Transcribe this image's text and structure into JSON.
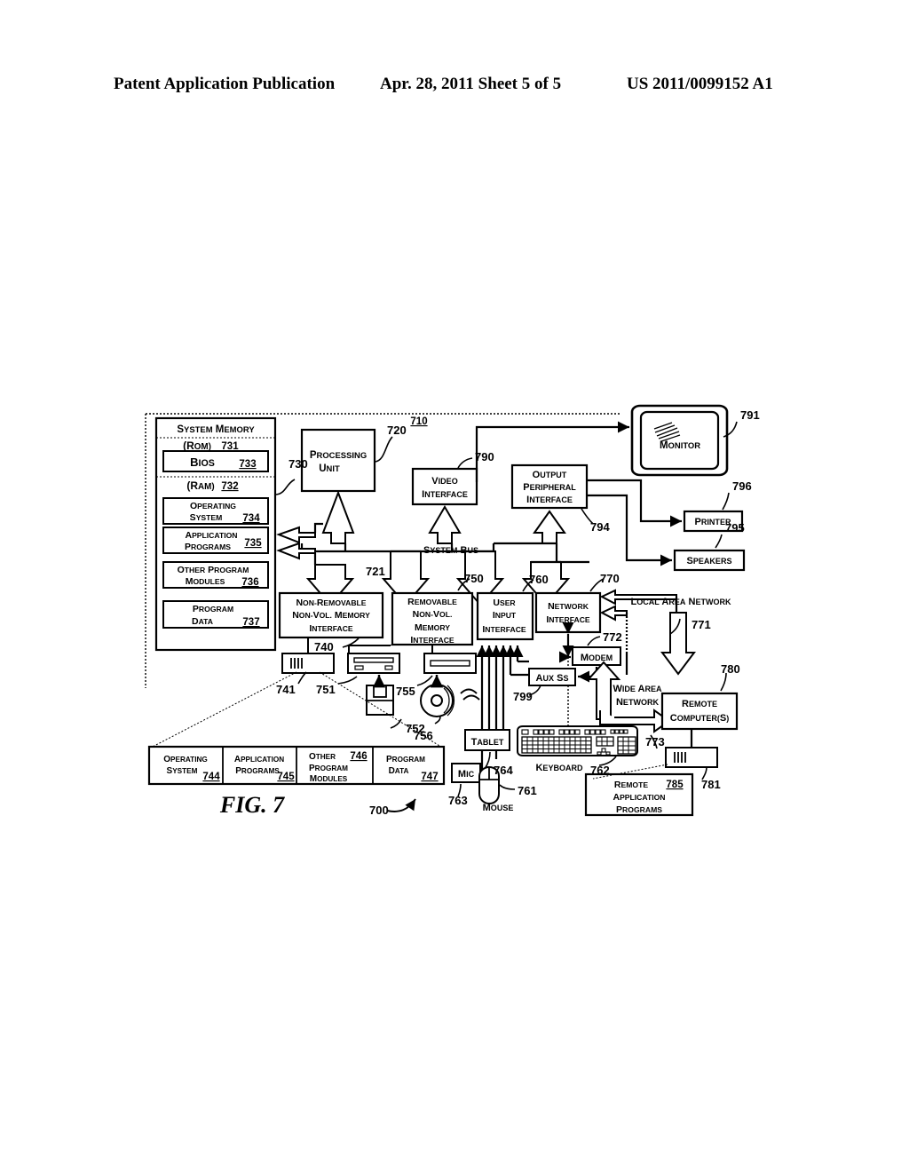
{
  "header": {
    "left": "Patent Application Publication",
    "middle": "Apr. 28, 2011  Sheet 5 of 5",
    "right": "US 2011/0099152 A1"
  },
  "figure": {
    "label": "FIG. 7",
    "ref": "700"
  },
  "diagram": {
    "computer_ref": "710",
    "system_memory": {
      "title": "System Memory",
      "rom_label": "(ROM)",
      "rom_ref": "731",
      "bios_label": "BIOS",
      "bios_ref": "733",
      "ram_label": "(RAM)",
      "ram_ref": "732",
      "memory_ref": "730",
      "blocks": [
        {
          "line1": "Operating",
          "line2": "System",
          "ref": "734"
        },
        {
          "line1": "Application",
          "line2": "Programs",
          "ref": "735"
        },
        {
          "line1": "Other Program",
          "line2": "Modules",
          "ref": "736"
        },
        {
          "line1": "Program",
          "line2": "Data",
          "ref": "737"
        }
      ]
    },
    "processing_unit": {
      "line1": "Processing",
      "line2": "Unit",
      "ref": "720"
    },
    "system_bus": {
      "label": "System Bus",
      "ref": "721"
    },
    "video_interface": {
      "line1": "Video",
      "line2": "Interface",
      "ref": "790"
    },
    "output_peripheral_interface": {
      "line1": "Output",
      "line2": "Peripheral",
      "line3": "Interface",
      "ref": "794"
    },
    "monitor": {
      "label": "Monitor",
      "ref": "791"
    },
    "printer": {
      "label": "Printer",
      "ref": "796"
    },
    "speakers": {
      "label": "Speakers",
      "ref": "795"
    },
    "non_removable_interface": {
      "line1": "Non-Removable",
      "line2": "Non-Vol. Memory",
      "line3": "Interface",
      "ref": "740"
    },
    "removable_interface": {
      "line1": "Removable",
      "line2": "Non-Vol.",
      "line3": "Memory",
      "line4": "Interface",
      "ref": "750"
    },
    "user_input_interface": {
      "line1": "User",
      "line2": "Input",
      "line3": "Interface",
      "ref": "760"
    },
    "network_interface": {
      "line1": "Network",
      "line2": "Interface",
      "ref": "770"
    },
    "hard_drive_ref": "741",
    "floppy_drive_ref": "751",
    "floppy_disk_ref": "752",
    "optical_drive_ref": "755",
    "optical_disc_ref": "756",
    "modem": {
      "label": "Modem",
      "ref": "772"
    },
    "aux_ss": {
      "label": "Aux SS",
      "ref": "799"
    },
    "local_area_network": {
      "label": "Local Area Network",
      "ref": "771"
    },
    "wide_area_network": {
      "label": "Wide Area Network",
      "ref": "773"
    },
    "remote_computers": {
      "line1": "Remote",
      "line2": "Computer(s)",
      "ref": "780"
    },
    "remote_memory_ref": "781",
    "remote_application_programs": {
      "line1": "Remote",
      "line2": "Application",
      "line3": "Programs",
      "ref": "785"
    },
    "tablet": {
      "label": "Tablet",
      "ref": "764"
    },
    "mic": {
      "label": "Mic",
      "ref": "763"
    },
    "mouse": {
      "label": "Mouse",
      "ref": "761"
    },
    "keyboard": {
      "label": "Keyboard",
      "ref": "762"
    },
    "storage_detail": [
      {
        "line1": "Operating",
        "line2": "System",
        "ref": "744"
      },
      {
        "line1": "Application",
        "line2": "Programs",
        "ref": "745"
      },
      {
        "line1": "Other",
        "line2": "Program",
        "line3": "Modules",
        "ref": "746"
      },
      {
        "line1": "Program",
        "line2": "Data",
        "ref": "747"
      }
    ]
  }
}
